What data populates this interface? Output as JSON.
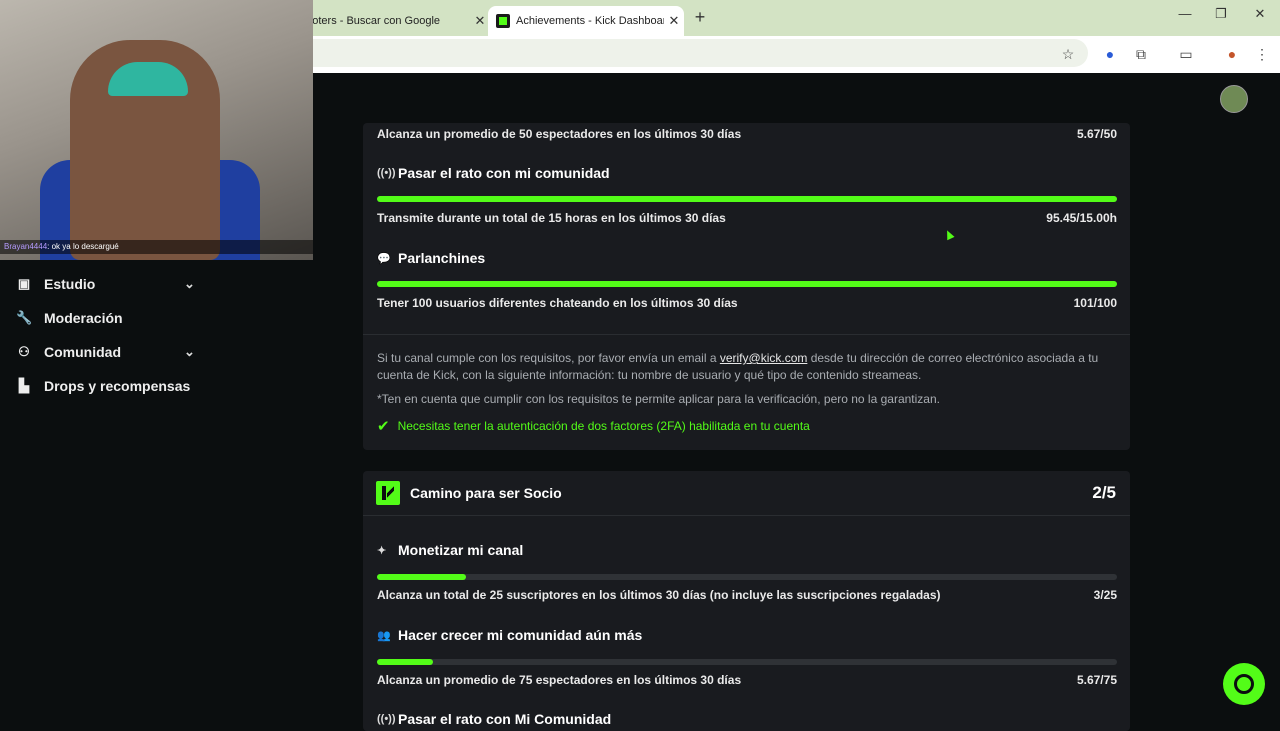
{
  "browser": {
    "tabs": [
      {
        "title": "hooters - Buscar con Google",
        "active": false
      },
      {
        "title": "Achievements - Kick Dashboard",
        "active": true
      }
    ],
    "new_tab": "+",
    "window_controls": [
      "—",
      "❐",
      "✕"
    ],
    "toolbar_icons": [
      "star-icon",
      "extension-icon",
      "puzzle-icon",
      "sidepanel-icon",
      "profile-icon",
      "menu-icon"
    ]
  },
  "webcam": {
    "chat_user": "Brayan4444",
    "chat_message": ": ok ya lo descargué"
  },
  "sidebar": {
    "items": [
      {
        "label": "Estudio",
        "icon": "studio-icon",
        "expandable": true
      },
      {
        "label": "Moderación",
        "icon": "wrench-icon",
        "expandable": false
      },
      {
        "label": "Comunidad",
        "icon": "community-icon",
        "expandable": true
      },
      {
        "label": "Drops y recompensas",
        "icon": "drops-icon",
        "expandable": false
      }
    ]
  },
  "verification_card": {
    "items": [
      {
        "title": null,
        "requirement": "Alcanza un promedio de 50 espectadores en los últimos 30 días",
        "value": "5.67/50",
        "progress": null
      },
      {
        "title": "Pasar el rato con mi comunidad",
        "icon": "broadcast-icon",
        "requirement": "Transmite durante un total de 15 horas en los últimos 30 días",
        "value": "95.45/15.00h",
        "progress": 1.0
      },
      {
        "title": "Parlanchines",
        "icon": "chat-bubble-icon",
        "requirement": "Tener 100 usuarios diferentes chateando en los últimos 30 días",
        "value": "101/100",
        "progress": 1.0
      }
    ],
    "info_line1_pre": "Si tu canal cumple con los requisitos, por favor envía un email a ",
    "info_email": "verify@kick.com",
    "info_line1_post": " desde tu dirección de correo electrónico asociada a tu cuenta de Kick, con la siguiente información: tu nombre de usuario y qué tipo de contenido streameas.",
    "info_line2": "*Ten en cuenta que cumplir con los requisitos te permite aplicar para la verificación, pero no la garantizan.",
    "twofa": "Necesitas tener la autenticación de dos factores (2FA) habilitada en tu cuenta"
  },
  "partner_card": {
    "title": "Camino para ser Socio",
    "progress": "2/5",
    "items": [
      {
        "title": "Monetizar mi canal",
        "icon": "sparkle-icon",
        "requirement": "Alcanza un total de 25 suscriptores en los últimos 30 días (no incluye las suscripciones regaladas)",
        "value": "3/25",
        "progress": 0.12
      },
      {
        "title": "Hacer crecer mi comunidad aún más",
        "icon": "people-icon",
        "requirement": "Alcanza un promedio de 75 espectadores en los últimos 30 días",
        "value": "5.67/75",
        "progress": 0.076
      },
      {
        "title": "Pasar el rato con Mi Comunidad",
        "icon": "broadcast-icon"
      }
    ]
  },
  "colors": {
    "accent": "#53fc18",
    "card": "#191b1f",
    "page": "#0b0e0f"
  }
}
